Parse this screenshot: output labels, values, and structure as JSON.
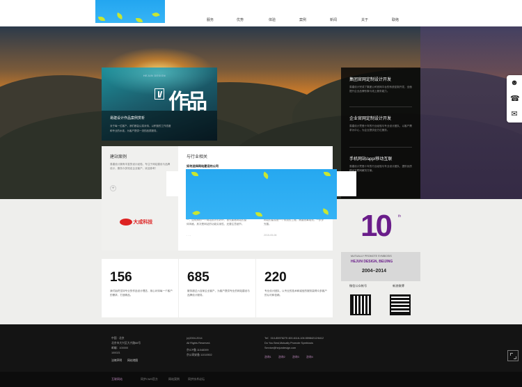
{
  "nav": {
    "items": [
      "服务",
      "优势",
      "体验",
      "案例",
      "新闻",
      "关于",
      "联络"
    ]
  },
  "feature": {
    "tag": "HEJUN DESIGN",
    "title": "易建设计作品案例赏析",
    "desc1": "对于每一位客户，我们都会认真对待，以积极的工作态度",
    "desc2": "和专业的水准，为客户提供一流的品质服务。",
    "calligraphy": "作品"
  },
  "news_dark": [
    {
      "title": "集团官网定制设计开发",
      "body": "易建设计完成了集团公司官网平台的系统定制开发，全面提升企业品牌形象与线上服务能力。"
    },
    {
      "title": "企业官网定制设计开发",
      "body": "易建设计凭借十年的行业经验与专业设计团队，以客户需求为中心，为企业提供全方位服务。"
    },
    {
      "title": "手机网站/app/移动互联",
      "body": "易建设计凭借十年的行业经验与专业设计团队，提供优质移动互联网解决方案。"
    }
  ],
  "cases": {
    "c1_title": "建站案例",
    "c1_body": "易建设计拥有丰富的设计经验，专注于网站建设与品牌设计，服务众多知名企业客户，欢迎参考！",
    "c1_more": "+",
    "c2_title": "与行业相关",
    "c2_sub": "如何选择网站建设的公司",
    "c2_body": "一、如何辨别一个网站设计的好坏，首先要看网站的整体风格，其次是网站的功能实用性，还要注意细节。",
    "c2_more": "· · ·",
    "c3_body": "网站的建设是一个系统的工程，需要统筹规划，一步步完善。",
    "c3_date": "2015-05-08"
  },
  "partner_logo": "大成科技",
  "stats": [
    {
      "num": "156",
      "text": "我们始终坚持专业的作品设计理念，用心对待每一个客户的需求，打造精品。"
    },
    {
      "num": "685",
      "text": "服务超过六百家企业客户，为客户提供专业的网站建设与品牌设计服务。"
    },
    {
      "num": "220",
      "text": "专业设计团队，以专业的技术和诚信的服务赢得众多客户的认可和信赖。"
    }
  ],
  "anniv": {
    "big": "10",
    "sup": "th",
    "line1": "MUTUALLY PROMOTE SYMBIOSIS",
    "line2": "HEJUN DESIGN, BEIJING",
    "years": "2004–2014",
    "qr1": "微信公众帐号",
    "qr2": "新浪微博"
  },
  "footer": {
    "col1": [
      "中国 · 北京",
      "北京市大兴区大兴路88号",
      "邮编：100000",
      "100021"
    ],
    "col1_links": [
      "法律声明",
      "网站地图"
    ],
    "col2": [
      "(c)2004-2014",
      "All Rights Reserved.",
      "京ICP备 11048399",
      "京公网安备 11010502"
    ],
    "col3": [
      "Tel：010-85976275 400-6116-106 85984212/6412",
      "Do You Best,Mutually Promote Symbiosis",
      "Service@hejundesign.com"
    ],
    "col3_icons": [
      "咨询1",
      "咨询2",
      "咨询3",
      "咨询4"
    ],
    "bottom": [
      "互联网站",
      "同步CMS官方",
      "网站案例",
      "同步技术论坛"
    ]
  },
  "colors": {
    "accent": "#6a1d8a",
    "dark": "#141414",
    "teal": "#1e8f9a"
  }
}
